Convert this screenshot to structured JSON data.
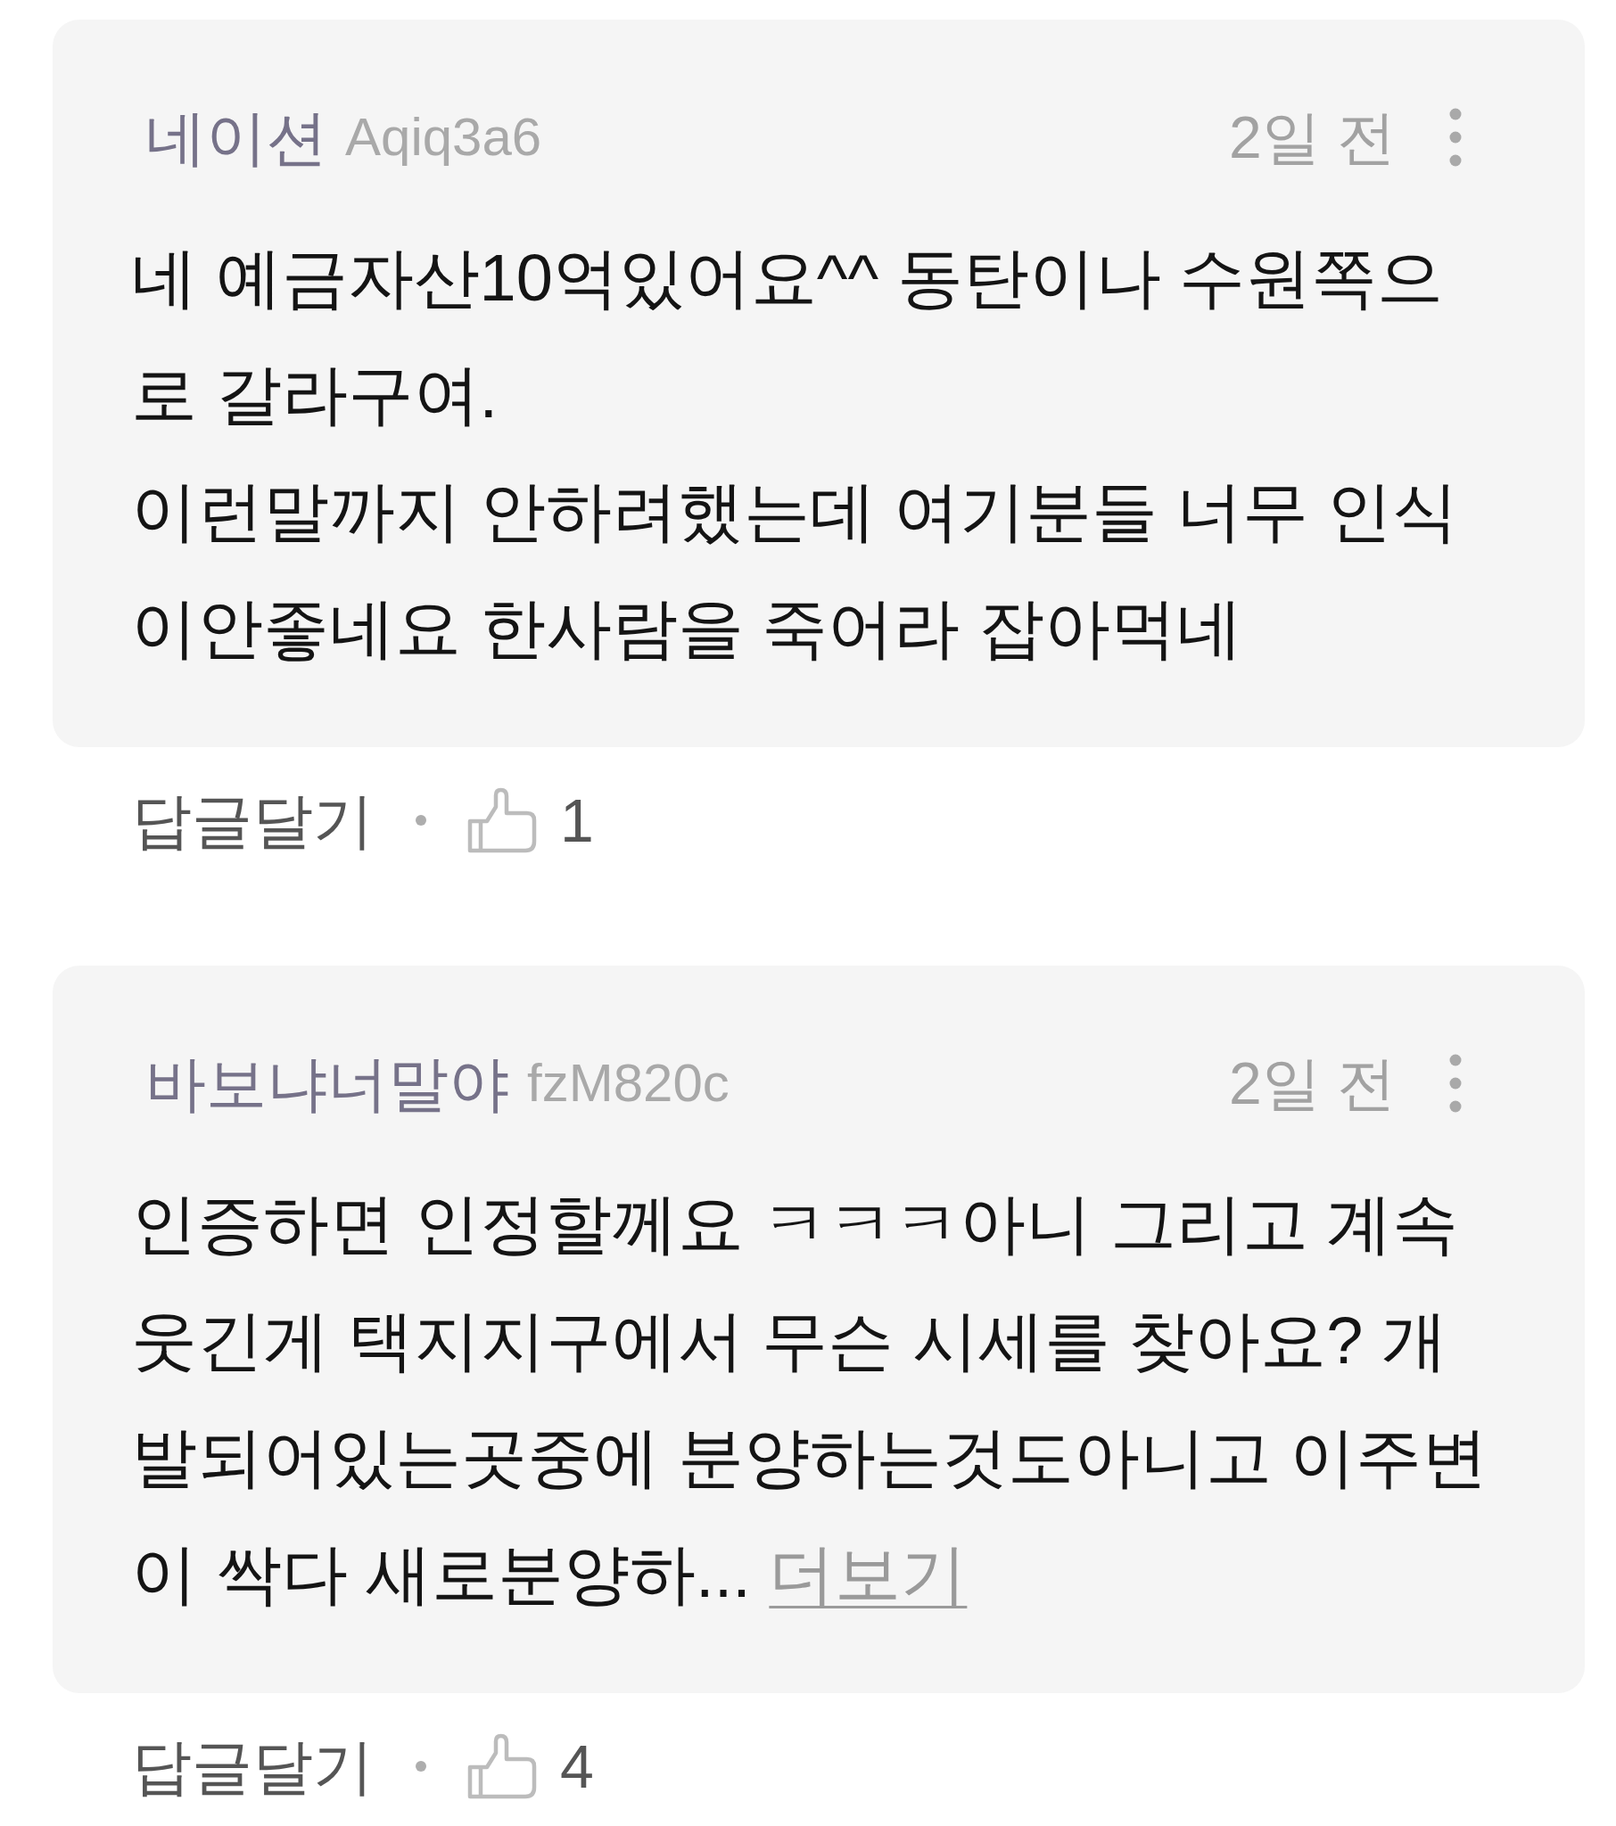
{
  "comments": [
    {
      "author": "네이션",
      "user_id": "Aqiq3a6",
      "time": "2일 전",
      "text": "네 예금자산10억있어요^^ 동탄이나 수원쪽으로 갈라구여.\n이런말까지 안하려했는데 여기분들 너무 인식이안좋네요 한사람을 죽어라 잡아먹네",
      "reply_label": "답글달기",
      "likes": "1"
    },
    {
      "author": "바보냐너말야",
      "user_id": "fzM820c",
      "time": "2일 전",
      "text": "인증하면 인정할께요 ㅋㅋㅋ아니 그리고 계속 웃긴게 택지지구에서 무슨 시세를 찾아요? 개발되어있는곳중에 분양하는것도아니고 이주변이 싹다 새로분양하...",
      "more_link": "더보기",
      "reply_label": "답글달기",
      "likes": "4"
    }
  ]
}
